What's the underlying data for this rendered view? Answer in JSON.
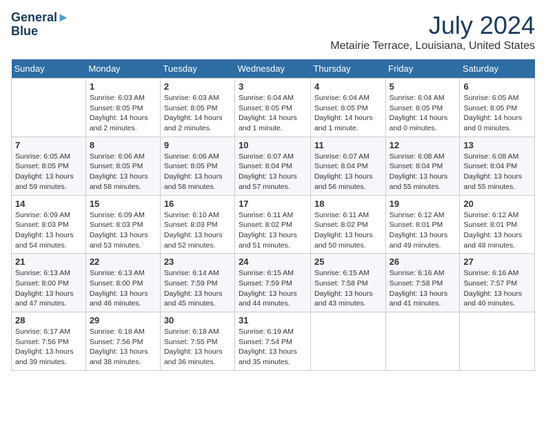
{
  "logo": {
    "line1": "General",
    "line2": "Blue"
  },
  "title": "July 2024",
  "location": "Metairie Terrace, Louisiana, United States",
  "weekdays": [
    "Sunday",
    "Monday",
    "Tuesday",
    "Wednesday",
    "Thursday",
    "Friday",
    "Saturday"
  ],
  "weeks": [
    [
      {
        "day": "",
        "info": ""
      },
      {
        "day": "1",
        "info": "Sunrise: 6:03 AM\nSunset: 8:05 PM\nDaylight: 14 hours\nand 2 minutes."
      },
      {
        "day": "2",
        "info": "Sunrise: 6:03 AM\nSunset: 8:05 PM\nDaylight: 14 hours\nand 2 minutes."
      },
      {
        "day": "3",
        "info": "Sunrise: 6:04 AM\nSunset: 8:05 PM\nDaylight: 14 hours\nand 1 minute."
      },
      {
        "day": "4",
        "info": "Sunrise: 6:04 AM\nSunset: 8:05 PM\nDaylight: 14 hours\nand 1 minute."
      },
      {
        "day": "5",
        "info": "Sunrise: 6:04 AM\nSunset: 8:05 PM\nDaylight: 14 hours\nand 0 minutes."
      },
      {
        "day": "6",
        "info": "Sunrise: 6:05 AM\nSunset: 8:05 PM\nDaylight: 14 hours\nand 0 minutes."
      }
    ],
    [
      {
        "day": "7",
        "info": ""
      },
      {
        "day": "8",
        "info": "Sunrise: 6:06 AM\nSunset: 8:05 PM\nDaylight: 13 hours\nand 58 minutes."
      },
      {
        "day": "9",
        "info": "Sunrise: 6:06 AM\nSunset: 8:05 PM\nDaylight: 13 hours\nand 58 minutes."
      },
      {
        "day": "10",
        "info": "Sunrise: 6:07 AM\nSunset: 8:04 PM\nDaylight: 13 hours\nand 57 minutes."
      },
      {
        "day": "11",
        "info": "Sunrise: 6:07 AM\nSunset: 8:04 PM\nDaylight: 13 hours\nand 56 minutes."
      },
      {
        "day": "12",
        "info": "Sunrise: 6:08 AM\nSunset: 8:04 PM\nDaylight: 13 hours\nand 55 minutes."
      },
      {
        "day": "13",
        "info": "Sunrise: 6:08 AM\nSunset: 8:04 PM\nDaylight: 13 hours\nand 55 minutes."
      }
    ],
    [
      {
        "day": "14",
        "info": ""
      },
      {
        "day": "15",
        "info": "Sunrise: 6:09 AM\nSunset: 8:03 PM\nDaylight: 13 hours\nand 53 minutes."
      },
      {
        "day": "16",
        "info": "Sunrise: 6:10 AM\nSunset: 8:03 PM\nDaylight: 13 hours\nand 52 minutes."
      },
      {
        "day": "17",
        "info": "Sunrise: 6:11 AM\nSunset: 8:02 PM\nDaylight: 13 hours\nand 51 minutes."
      },
      {
        "day": "18",
        "info": "Sunrise: 6:11 AM\nSunset: 8:02 PM\nDaylight: 13 hours\nand 50 minutes."
      },
      {
        "day": "19",
        "info": "Sunrise: 6:12 AM\nSunset: 8:01 PM\nDaylight: 13 hours\nand 49 minutes."
      },
      {
        "day": "20",
        "info": "Sunrise: 6:12 AM\nSunset: 8:01 PM\nDaylight: 13 hours\nand 48 minutes."
      }
    ],
    [
      {
        "day": "21",
        "info": ""
      },
      {
        "day": "22",
        "info": "Sunrise: 6:13 AM\nSunset: 8:00 PM\nDaylight: 13 hours\nand 46 minutes."
      },
      {
        "day": "23",
        "info": "Sunrise: 6:14 AM\nSunset: 7:59 PM\nDaylight: 13 hours\nand 45 minutes."
      },
      {
        "day": "24",
        "info": "Sunrise: 6:15 AM\nSunset: 7:59 PM\nDaylight: 13 hours\nand 44 minutes."
      },
      {
        "day": "25",
        "info": "Sunrise: 6:15 AM\nSunset: 7:58 PM\nDaylight: 13 hours\nand 43 minutes."
      },
      {
        "day": "26",
        "info": "Sunrise: 6:16 AM\nSunset: 7:58 PM\nDaylight: 13 hours\nand 41 minutes."
      },
      {
        "day": "27",
        "info": "Sunrise: 6:16 AM\nSunset: 7:57 PM\nDaylight: 13 hours\nand 40 minutes."
      }
    ],
    [
      {
        "day": "28",
        "info": "Sunrise: 6:17 AM\nSunset: 7:56 PM\nDaylight: 13 hours\nand 39 minutes."
      },
      {
        "day": "29",
        "info": "Sunrise: 6:18 AM\nSunset: 7:56 PM\nDaylight: 13 hours\nand 38 minutes."
      },
      {
        "day": "30",
        "info": "Sunrise: 6:18 AM\nSunset: 7:55 PM\nDaylight: 13 hours\nand 36 minutes."
      },
      {
        "day": "31",
        "info": "Sunrise: 6:19 AM\nSunset: 7:54 PM\nDaylight: 13 hours\nand 35 minutes."
      },
      {
        "day": "",
        "info": ""
      },
      {
        "day": "",
        "info": ""
      },
      {
        "day": "",
        "info": ""
      }
    ]
  ],
  "week1_day7_info": "Sunrise: 6:05 AM\nSunset: 8:05 PM\nDaylight: 13 hours\nand 59 minutes.",
  "week2_day7_info": "Sunrise: 6:09 AM\nSunset: 8:03 PM\nDaylight: 13 hours\nand 54 minutes.",
  "week3_day21_info": "Sunrise: 6:13 AM\nSunset: 8:00 PM\nDaylight: 13 hours\nand 47 minutes.",
  "week4_day21_info": "Sunrise: 6:13 AM\nSunset: 8:00 PM\nDaylight: 13 hours\nand 47 minutes."
}
